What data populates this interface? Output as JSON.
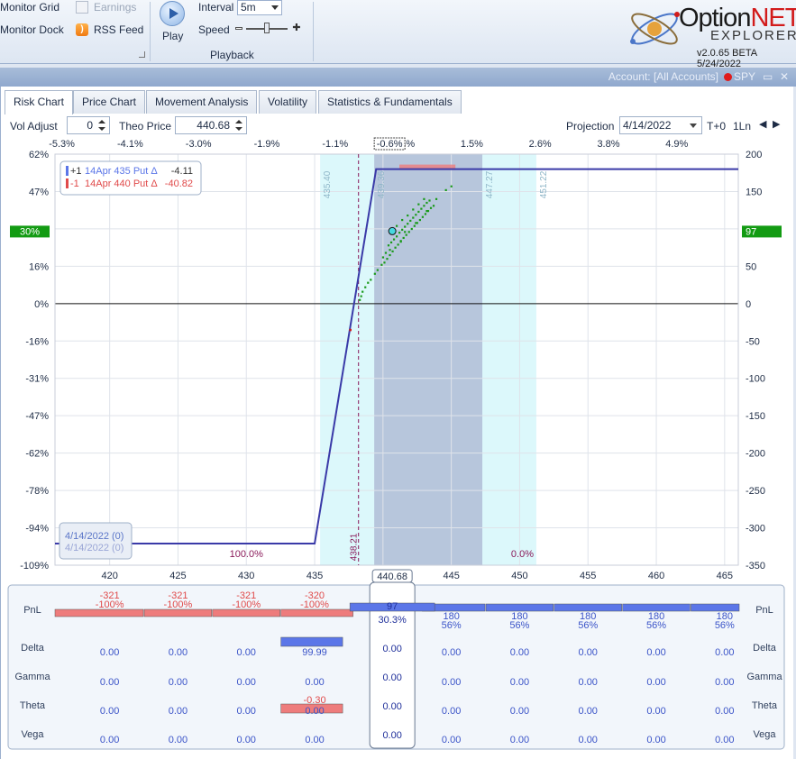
{
  "ribbon": {
    "monitor_grid": "Monitor Grid",
    "monitor_dock": "Monitor Dock",
    "earnings": "Earnings",
    "rss_feed": "RSS Feed",
    "play": "Play",
    "interval_label": "Interval",
    "interval_value": "5m",
    "speed_label": "Speed",
    "playback_group": "Playback",
    "logo_option": "Option",
    "logo_net": "NET",
    "logo_explorer": "EXPLORER",
    "version": "v2.0.65 BETA 5/24/2022"
  },
  "account_bar": {
    "account": "Account: [All Accounts]",
    "symbol": "SPY"
  },
  "tabs": [
    "Risk Chart",
    "Price Chart",
    "Movement Analysis",
    "Volatility",
    "Statistics & Fundamentals"
  ],
  "controls": {
    "vol_adjust_label": "Vol Adjust",
    "vol_adjust_value": "0",
    "theo_price_label": "Theo Price",
    "theo_price_value": "440.68",
    "projection_label": "Projection",
    "projection_date": "4/14/2022",
    "t_plus": "T+0",
    "lines": "1Ln"
  },
  "colors": {
    "plot_line": "#3a3aa8",
    "band_light": "#dcf8fb",
    "band_dark": "#b7c6dc",
    "positive": "#5b76e8",
    "negative": "#ee7c7c",
    "scatter": "#1a9a1a",
    "badge_green": "#139b13"
  },
  "chart_data": {
    "type": "line",
    "title": "",
    "xlabel": "",
    "ylabel": "",
    "xlim": [
      416,
      466
    ],
    "ylim_pct": [
      -109,
      62
    ],
    "ylim_pnl": [
      -350,
      200
    ],
    "x_ticks": [
      420,
      425,
      430,
      435,
      440,
      445,
      450,
      455,
      460,
      465
    ],
    "top_pct_ticks": [
      {
        "price": 416.5,
        "label": "-5.3%"
      },
      {
        "price": 421.5,
        "label": "-4.1%"
      },
      {
        "price": 426.5,
        "label": "-3.0%"
      },
      {
        "price": 431.5,
        "label": "-1.9%"
      },
      {
        "price": 436.5,
        "label": "-1.1%"
      },
      {
        "price": 441.5,
        "label": "0.4%"
      },
      {
        "price": 446.5,
        "label": "1.5%"
      },
      {
        "price": 451.5,
        "label": "2.6%"
      },
      {
        "price": 456.5,
        "label": "3.8%"
      },
      {
        "price": 461.5,
        "label": "4.9%"
      }
    ],
    "current_pct_label": "-0.6%",
    "y_left_ticks": [
      "62%",
      "47%",
      "31%",
      "16%",
      "0%",
      "-16%",
      "-31%",
      "-47%",
      "-62%",
      "-78%",
      "-94%",
      "-109%"
    ],
    "y_right_ticks": [
      200,
      150,
      100,
      50,
      0,
      -50,
      -100,
      -150,
      -200,
      -250,
      -300,
      -350
    ],
    "expiry_series": {
      "name": "4/14/2022 (0)",
      "x": [
        416,
        435,
        439.5,
        466
      ],
      "y": [
        -321,
        -321,
        180,
        180
      ]
    },
    "current_price": 440.68,
    "breakeven": 438.21,
    "current_pnl": 97,
    "current_pct": "30%",
    "current_pnl_pct": "30.3%",
    "bands": [
      {
        "from": 435.4,
        "to": 451.22,
        "shade": "light"
      },
      {
        "from": 439.36,
        "to": 447.27,
        "shade": "dark"
      }
    ],
    "band_labels": [
      "435.40",
      "439.36",
      "447.27",
      "451.22"
    ],
    "bottom_pct_labels": [
      {
        "price": 430,
        "label": "100.0%"
      },
      {
        "price": 450.2,
        "label": "0.0%"
      }
    ],
    "breakeven_label": "438.21",
    "max_profit_marker": {
      "from": 441.2,
      "to": 445.3,
      "y": 180
    },
    "scatter": [
      [
        439.9,
        52
      ],
      [
        440.1,
        55
      ],
      [
        440.3,
        60
      ],
      [
        440.5,
        65
      ],
      [
        440.7,
        70
      ],
      [
        440.9,
        75
      ],
      [
        441.1,
        79
      ],
      [
        441.3,
        84
      ],
      [
        441.5,
        88
      ],
      [
        441.7,
        92
      ],
      [
        441.9,
        96
      ],
      [
        442.1,
        100
      ],
      [
        442.3,
        104
      ],
      [
        442.5,
        108
      ],
      [
        442.7,
        112
      ],
      [
        442.9,
        116
      ],
      [
        443.1,
        120
      ],
      [
        443.3,
        124
      ],
      [
        443.5,
        128
      ],
      [
        443.7,
        131
      ],
      [
        440.4,
        78
      ],
      [
        440.6,
        82
      ],
      [
        440.8,
        86
      ],
      [
        441.0,
        90
      ],
      [
        441.2,
        95
      ],
      [
        441.4,
        99
      ],
      [
        441.6,
        103
      ],
      [
        441.8,
        107
      ],
      [
        442.0,
        111
      ],
      [
        442.2,
        115
      ],
      [
        442.4,
        119
      ],
      [
        442.6,
        123
      ],
      [
        442.8,
        127
      ],
      [
        443.0,
        131
      ],
      [
        443.2,
        135
      ],
      [
        443.4,
        138
      ],
      [
        441.0,
        104
      ],
      [
        441.4,
        112
      ],
      [
        441.8,
        118
      ],
      [
        442.2,
        126
      ],
      [
        442.6,
        133
      ],
      [
        443.0,
        140
      ],
      [
        439.6,
        45
      ],
      [
        439.4,
        40
      ],
      [
        439.1,
        32
      ],
      [
        438.9,
        28
      ],
      [
        438.7,
        22
      ],
      [
        438.5,
        16
      ],
      [
        438.4,
        10
      ],
      [
        438.3,
        5
      ],
      [
        440.2,
        68
      ],
      [
        440.0,
        62
      ],
      [
        441.6,
        96
      ],
      [
        442.4,
        108
      ],
      [
        443.2,
        124
      ],
      [
        443.9,
        140
      ],
      [
        444.6,
        152
      ],
      [
        445.0,
        157
      ],
      [
        441.3,
        83
      ],
      [
        440.5,
        72
      ]
    ],
    "negative_point": [
      437.6,
      -35
    ],
    "legend": [
      {
        "sign": "+1",
        "text": "14Apr 435 Put Δ",
        "delta": "-4.11"
      },
      {
        "sign": "-1",
        "text": "14Apr 440 Put Δ",
        "delta": "-40.82"
      }
    ],
    "date_box": [
      "4/14/2022 (0)",
      "4/14/2022 (0)"
    ]
  },
  "greeks_table": {
    "row_labels": [
      "PnL",
      "Delta",
      "Gamma",
      "Theta",
      "Vega"
    ],
    "columns": [
      {
        "price": 420,
        "pnl_pct": "-100%",
        "pnl": "-321",
        "delta": "0.00",
        "gamma": "0.00",
        "theta": "0.00",
        "vega": "0.00"
      },
      {
        "price": 425,
        "pnl_pct": "-100%",
        "pnl": "-321",
        "delta": "0.00",
        "gamma": "0.00",
        "theta": "0.00",
        "vega": "0.00"
      },
      {
        "price": 430,
        "pnl_pct": "-100%",
        "pnl": "-321",
        "delta": "0.00",
        "gamma": "0.00",
        "theta": "0.00",
        "vega": "0.00"
      },
      {
        "price": 435,
        "pnl_pct": "-100%",
        "pnl": "-320",
        "delta": "99.99",
        "gamma": "0.00",
        "theta": "-0.30",
        "vega": "0.00"
      },
      {
        "price": 440.68,
        "pnl_pct": "30.3%",
        "pnl": "97",
        "delta": "0.00",
        "gamma": "0.00",
        "theta": "0.00",
        "vega": "0.00"
      },
      {
        "price": 445,
        "pnl_pct": "56%",
        "pnl": "180",
        "delta": "0.00",
        "gamma": "0.00",
        "theta": "0.00",
        "vega": "0.00"
      },
      {
        "price": 450,
        "pnl_pct": "56%",
        "pnl": "180",
        "delta": "0.00",
        "gamma": "0.00",
        "theta": "0.00",
        "vega": "0.00"
      },
      {
        "price": 455,
        "pnl_pct": "56%",
        "pnl": "180",
        "delta": "0.00",
        "gamma": "0.00",
        "theta": "0.00",
        "vega": "0.00"
      },
      {
        "price": 460,
        "pnl_pct": "56%",
        "pnl": "180",
        "delta": "0.00",
        "gamma": "0.00",
        "theta": "0.00",
        "vega": "0.00"
      },
      {
        "price": 465,
        "pnl_pct": "56%",
        "pnl": "180",
        "delta": "0.00",
        "gamma": "0.00",
        "theta": "0.00",
        "vega": "0.00"
      }
    ]
  }
}
